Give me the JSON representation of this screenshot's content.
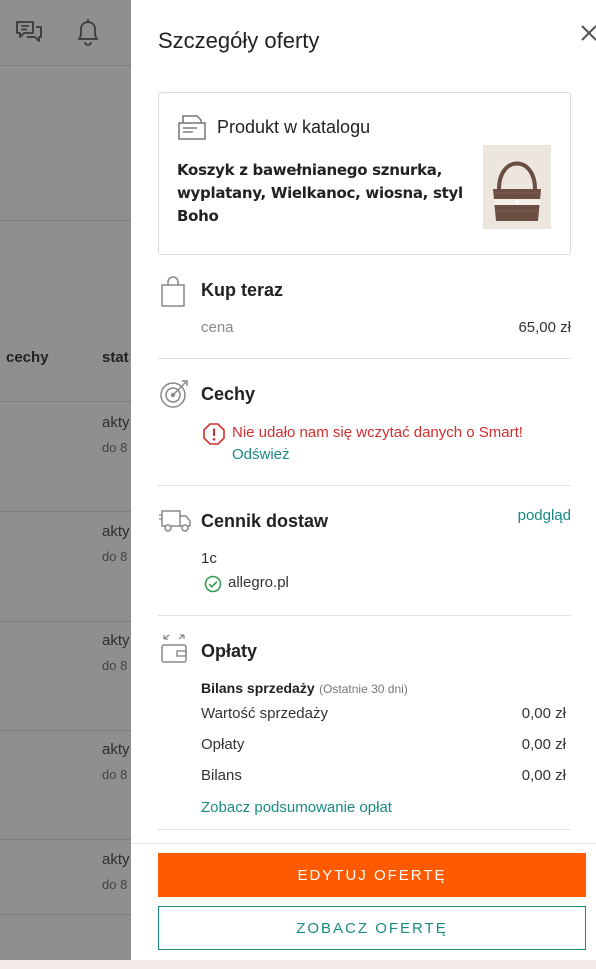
{
  "background": {
    "column_cechy": "cechy",
    "column_status": "stat",
    "rows": [
      {
        "status": "akty",
        "sub": "do 8"
      },
      {
        "status": "akty",
        "sub": "do 8"
      },
      {
        "status": "akty",
        "sub": "do 8"
      },
      {
        "status": "akty",
        "sub": "do 8"
      },
      {
        "status": "akty",
        "sub": "do 8"
      }
    ]
  },
  "panel": {
    "title": "Szczegóły oferty",
    "catalog": {
      "title": "Produkt w katalogu",
      "product_name": "Koszyk z bawełnianego sznurka, wyplatany, Wielkanoc, wiosna, styl Boho"
    },
    "buy_now": {
      "title": "Kup teraz",
      "price_label": "cena",
      "price_value": "65,00 zł"
    },
    "features": {
      "title": "Cechy",
      "error": "Nie udało nam się wczytać danych o Smart!",
      "refresh": "Odśwież"
    },
    "shipping": {
      "title": "Cennik dostaw",
      "preview_link": "podgląd",
      "tariff": "1c",
      "site": "allegro.pl"
    },
    "fees": {
      "title": "Opłaty",
      "subtitle": "Bilans sprzedaży",
      "subtitle_note": "(Ostatnie 30 dni)",
      "rows": [
        {
          "label": "Wartość sprzedaży",
          "value": "0,00 zł"
        },
        {
          "label": "Opłaty",
          "value": "0,00 zł"
        },
        {
          "label": "Bilans",
          "value": "0,00 zł"
        }
      ],
      "summary_link": "Zobacz podsumowanie opłat"
    },
    "buttons": {
      "edit": "EDYTUJ OFERTĘ",
      "view": "ZOBACZ OFERTĘ"
    }
  },
  "colors": {
    "accent": "#ff5a00",
    "link": "#1a8a83",
    "error": "#d32f2f",
    "success": "#2e9e4f"
  }
}
